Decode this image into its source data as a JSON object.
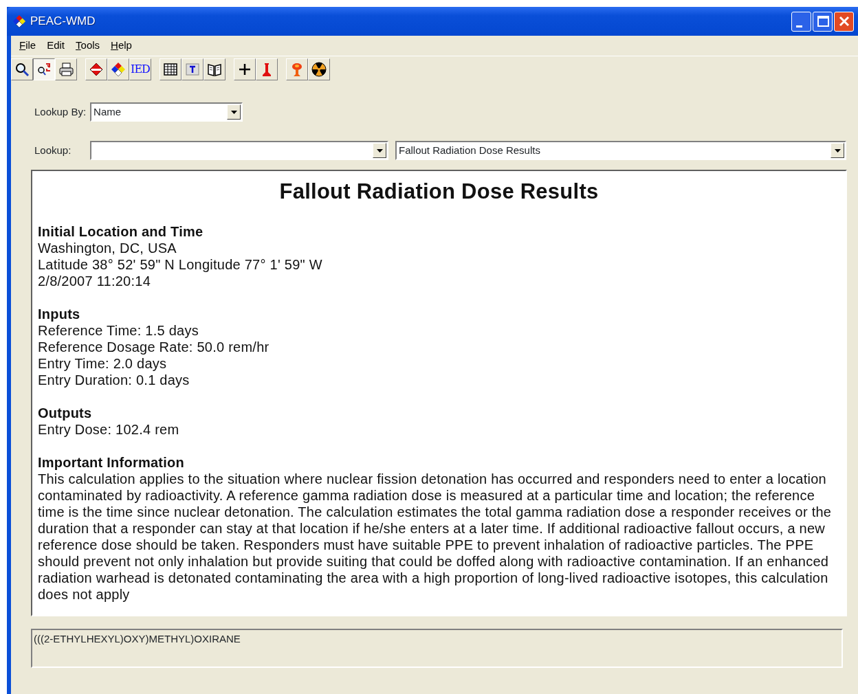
{
  "window": {
    "title": "PEAC-WMD"
  },
  "menu": [
    {
      "label": "File",
      "mnemonic": true
    },
    {
      "label": "Edit",
      "mnemonic": false
    },
    {
      "label": "Tools",
      "mnemonic": true
    },
    {
      "label": "Help",
      "mnemonic": true
    }
  ],
  "toolbar": [
    [
      {
        "kind": "magnifier",
        "pressed": false
      },
      {
        "kind": "search-arrows",
        "pressed": true
      },
      {
        "kind": "printer",
        "pressed": false
      }
    ],
    [
      {
        "kind": "red-diamond",
        "pressed": false
      },
      {
        "kind": "hazard-diamond",
        "pressed": false
      },
      {
        "kind": "text",
        "label": "IED",
        "pressed": false
      }
    ],
    [
      {
        "kind": "grid",
        "pressed": false
      },
      {
        "kind": "text-grid",
        "pressed": false
      },
      {
        "kind": "book",
        "pressed": false
      }
    ],
    [
      {
        "kind": "plus",
        "pressed": false
      },
      {
        "kind": "red-stand",
        "pressed": false
      }
    ],
    [
      {
        "kind": "mushroom-cloud",
        "pressed": false
      },
      {
        "kind": "radiation",
        "pressed": false
      }
    ]
  ],
  "lookup_by": {
    "label": "Lookup By:",
    "value": "Name"
  },
  "lookup": {
    "label": "Lookup:",
    "result_value": "Fallout Radiation Dose Results"
  },
  "report": {
    "title": "Fallout Radiation Dose Results",
    "sections": [
      {
        "heading": "Initial Location and Time",
        "lines": [
          "Washington, DC, USA",
          "Latitude 38° 52' 59\" N Longitude 77° 1' 59\" W",
          "2/8/2007 11:20:14"
        ]
      },
      {
        "heading": "Inputs",
        "lines": [
          "Reference Time: 1.5 days",
          "Reference Dosage Rate: 50.0 rem/hr",
          "Entry Time: 2.0 days",
          "Entry Duration: 0.1 days"
        ]
      },
      {
        "heading": "Outputs",
        "lines": [
          "Entry Dose: 102.4 rem"
        ]
      },
      {
        "heading": "Important Information",
        "lines": [
          "This calculation applies to the situation where nuclear fission detonation has occurred and responders need to enter a location contaminated by radioactivity. A reference gamma radiation dose is measured at a particular time and location; the reference time is the time since nuclear detonation. The calculation estimates the total gamma radiation dose a responder receives or the duration that a responder can stay at that location if he/she enters at a later time. If additional radioactive fallout occurs, a new reference dose should be taken. Responders must have suitable PPE to prevent inhalation of radioactive particles. The PPE should prevent not only inhalation but provide suiting that could be doffed along with radioactive contamination. If an enhanced radiation warhead is detonated contaminating the area with a high proportion of long-lived radioactive isotopes, this calculation does not apply"
        ]
      }
    ]
  },
  "status_field": {
    "value": "(((2-ETHYLHEXYL)OXY)METHYL)OXIRANE"
  }
}
